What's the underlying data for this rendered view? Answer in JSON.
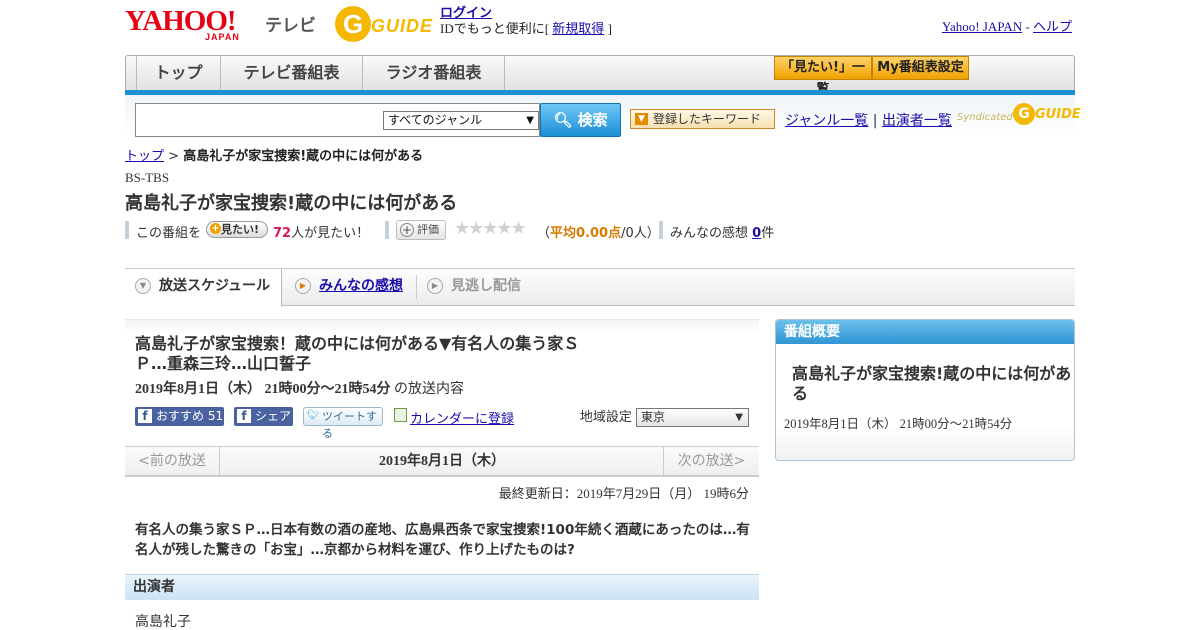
{
  "header": {
    "logo_text": "YAHOO!",
    "logo_sub": "JAPAN",
    "logo_tv": "テレビ",
    "gguide_text": "GUIDE",
    "login_label": "ログイン",
    "login_prompt": "IDでもっと便利に[",
    "signup_label": "新規取得",
    "login_suffix": "]",
    "yahoo_japan_link": "Yahoo! JAPAN",
    "separator": "-",
    "help_link": "ヘルプ"
  },
  "nav": {
    "tabs": [
      {
        "label": "トップ"
      },
      {
        "label": "テレビ番組表"
      },
      {
        "label": "ラジオ番組表"
      }
    ],
    "watchlist_label": "「見たい!」一覧",
    "my_schedule_label": "My番組表設定"
  },
  "search": {
    "input_value": "",
    "genre_selected": "すべてのジャンル",
    "search_button": "検索",
    "keyword_button": "登録したキーワード",
    "genre_list_link": "ジャンル一覧",
    "divider": "|",
    "performer_list_link": "出演者一覧",
    "syndicated_text": "Syndicated",
    "syndicated_logo": "GUIDE"
  },
  "breadcrumb": {
    "top_link": "トップ",
    "separator": ">",
    "current": "高島礼子が家宝捜索!蔵の中には何がある"
  },
  "program": {
    "channel": "BS-TBS",
    "title": "高島礼子が家宝捜索!蔵の中には何がある",
    "want_prefix": "この番組を",
    "want_button": "見たい!",
    "want_count": "72",
    "want_suffix": "人が見たい！",
    "rate_button": "評価",
    "stars": "★★★★★",
    "rating_open": "（",
    "rating_avg": "平均0.00点",
    "rating_people": "/0人）",
    "impressions_label": "みんなの感想",
    "impressions_count": "0",
    "impressions_unit": "件"
  },
  "tabs": [
    {
      "label": "放送スケジュール",
      "icon": "triangle-down-icon"
    },
    {
      "label": "みんなの感想",
      "icon": "play-icon"
    },
    {
      "label": "見逃し配信",
      "icon": "play-icon"
    }
  ],
  "episode": {
    "title": "高島礼子が家宝捜索！蔵の中には何がある▼有名人の集う家ＳＰ…重森三玲…山口誓子",
    "date": "2019年8月1日（木）  21時00分～21時54分",
    "date_suffix": "の放送内容",
    "fb_recommend": "おすすめ",
    "fb_count": "51",
    "fb_share": "シェア",
    "tweet": "ツイートする",
    "calendar": "カレンダーに登録",
    "region_label": "地域設定",
    "region_value": "東京"
  },
  "pager": {
    "prev": "<前の放送",
    "current": "2019年8月1日（木）",
    "next": "次の放送>"
  },
  "updated": "最終更新日：2019年7月29日（月）  19時6分",
  "synopsis": "有名人の集う家ＳＰ…日本有数の酒の産地、広島県西条で家宝捜索!100年続く酒蔵にあったのは…有名人が残した驚きの「お宝」…京都から材料を運び、作り上げたものは?",
  "cast": {
    "heading": "出演者",
    "names": [
      "高島礼子"
    ]
  },
  "sidebar": {
    "heading": "番組概要",
    "title": "高島礼子が家宝捜索!蔵の中には何がある",
    "date": "2019年8月1日（木）  21時00分～21時54分"
  },
  "colors": {
    "yahoo_red": "#e60012",
    "accent_blue": "#1e8fd3",
    "gguide_yellow": "#f5b800",
    "want_pink": "#d8175f",
    "rating_orange": "#d57b00"
  }
}
